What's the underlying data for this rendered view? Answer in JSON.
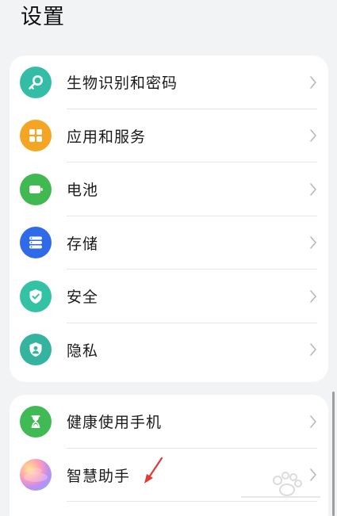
{
  "page": {
    "title": "设置"
  },
  "groups": [
    {
      "items": [
        {
          "label": "生物识别和密码",
          "icon": "key-icon",
          "color": "#33bda6"
        },
        {
          "label": "应用和服务",
          "icon": "apps-grid-icon",
          "color": "#f5a524"
        },
        {
          "label": "电池",
          "icon": "battery-icon",
          "color": "#3fb950"
        },
        {
          "label": "存储",
          "icon": "storage-icon",
          "color": "#2f6be8"
        },
        {
          "label": "安全",
          "icon": "shield-check-icon",
          "color": "#34c2a5"
        },
        {
          "label": "隐私",
          "icon": "privacy-shield-icon",
          "color": "#34b39e"
        }
      ]
    },
    {
      "items": [
        {
          "label": "健康使用手机",
          "icon": "hourglass-icon",
          "color": "#3fba54"
        },
        {
          "label": "智慧助手",
          "icon": "assistant-orb-icon",
          "color": "#b27ce6"
        }
      ]
    }
  ],
  "annotation": {
    "arrow_color": "#e53935"
  }
}
